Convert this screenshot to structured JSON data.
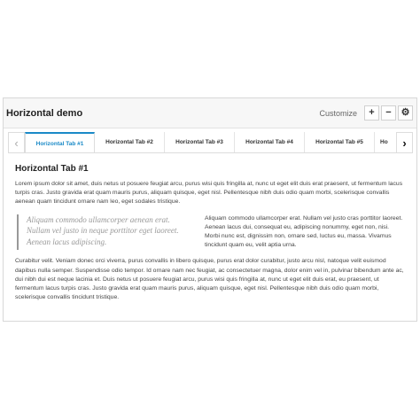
{
  "header": {
    "title": "Horizontal demo",
    "customize_label": "Customize",
    "add_label": "+",
    "remove_label": "−",
    "settings_label": "⚙"
  },
  "tabs": {
    "prev_label": "‹",
    "next_label": "›",
    "items": [
      {
        "label": "Horizontal Tab #1",
        "active": true
      },
      {
        "label": "Horizontal Tab #2",
        "active": false
      },
      {
        "label": "Horizontal Tab #3",
        "active": false
      },
      {
        "label": "Horizontal Tab #4",
        "active": false
      },
      {
        "label": "Horizontal Tab #5",
        "active": false
      },
      {
        "label": "Ho",
        "active": false
      }
    ]
  },
  "content": {
    "title": "Horizontal Tab #1",
    "para1": "Lorem ipsum dolor sit amet, duis netus ut posuere feugiat arcu, purus wisi quis fringilla at, nunc ut eget elit duis erat praesent, ut fermentum lacus turpis cras. Justo gravida erat quam mauris purus, aliquam quisque, eget nisl. Pellentesque nibh duis odio quam morbi, scelerisque convallis aenean quam tincidunt ornare nam leo, eget sodales tristique.",
    "quote": "Aliquam commodo ullamcorper aenean erat. Nullam vel justo in neque porttitor eget laoreet. Aenean lacus adipiscing.",
    "mid_text": "Aliquam commodo ullamcorper erat. Nullam vel justo cras porttitor laoreet. Aenean lacus dui, consequat eu, adipiscing nonummy, eget non, nisi. Morbi nunc est, dignissim non, ornare sed, luctus eu, massa. Vivamus tincidunt quam eu, velit aptia urna.",
    "para2": "Curabitur velit. Veniam donec orci viverra, purus convallis in libero quisque, purus erat dolor curabitur, justo arcu nisl, natoque velit euismod dapibus nulla semper. Suspendisse odio tempor. Id ornare nam nec feugiat, ac consectetuer magna, dolor enim vel in, pulvinar bibendum ante ac, dui nibh dui est neque lacinia et. Duis netus ut posuere feugiat arcu, purus wisi quis fringilla at, nunc ut eget elit duis erat, eu praesent, ut fermentum lacus turpis cras. Justo gravida erat quam mauris purus, aliquam quisque, eget nisl. Pellentesque nibh duis odio quam morbi, scelerisque convallis tincidunt tristique."
  },
  "colors": {
    "accent": "#1a8ac7",
    "border": "#d8d8d8",
    "quote_text": "#999999"
  }
}
